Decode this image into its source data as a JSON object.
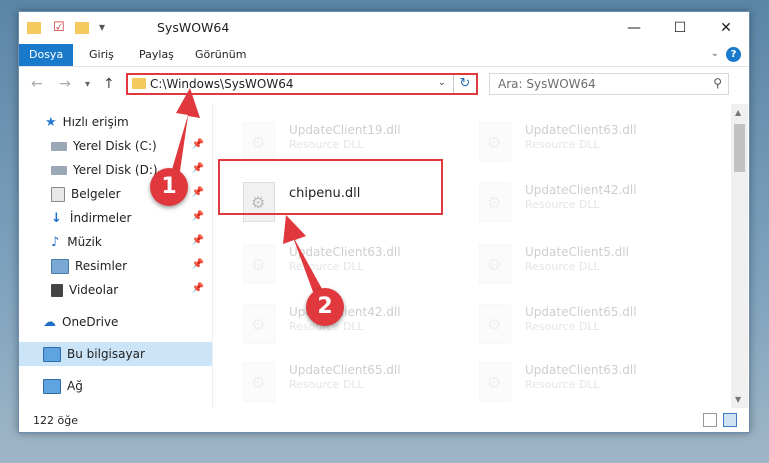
{
  "window": {
    "title": "SysWOW64"
  },
  "ribbon": {
    "tabs": [
      "Dosya",
      "Giriş",
      "Paylaş",
      "Görünüm"
    ]
  },
  "address": {
    "path": "C:\\Windows\\SysWOW64"
  },
  "search": {
    "placeholder": "Ara: SysWOW64"
  },
  "sidebar": {
    "items": [
      {
        "label": "Hızlı erişim",
        "icon": "star-icon"
      },
      {
        "label": "Yerel Disk (C:)",
        "icon": "drive-icon"
      },
      {
        "label": "Yerel Disk (D:)",
        "icon": "drive-icon"
      },
      {
        "label": "Belgeler",
        "icon": "documents-icon"
      },
      {
        "label": "İndirmeler",
        "icon": "download-icon"
      },
      {
        "label": "Müzik",
        "icon": "music-icon"
      },
      {
        "label": "Resimler",
        "icon": "pictures-icon"
      },
      {
        "label": "Videolar",
        "icon": "videos-icon"
      },
      {
        "label": "OneDrive",
        "icon": "cloud-icon"
      },
      {
        "label": "Bu bilgisayar",
        "icon": "computer-icon"
      },
      {
        "label": "Ağ",
        "icon": "network-icon"
      }
    ]
  },
  "files": {
    "left": [
      {
        "name": "UpdateClient19.dll",
        "type": "Resource DLL"
      },
      {
        "name": "chipenu.dll",
        "type": ""
      },
      {
        "name": "UpdateClient63.dll",
        "type": "Resource DLL"
      },
      {
        "name": "UpdateClient42.dll",
        "type": "Resource DLL"
      },
      {
        "name": "UpdateClient65.dll",
        "type": "Resource DLL"
      }
    ],
    "right": [
      {
        "name": "UpdateClient63.dll",
        "type": "Resource DLL"
      },
      {
        "name": "UpdateClient42.dll",
        "type": "Resource DLL"
      },
      {
        "name": "UpdateClient5.dll",
        "type": "Resource DLL"
      },
      {
        "name": "UpdateClient65.dll",
        "type": "Resource DLL"
      },
      {
        "name": "UpdateClient63.dll",
        "type": "Resource DLL"
      }
    ]
  },
  "status": {
    "count": "122 öğe"
  },
  "annotations": {
    "step1": "1",
    "step2": "2",
    "color": "#e0383c"
  }
}
